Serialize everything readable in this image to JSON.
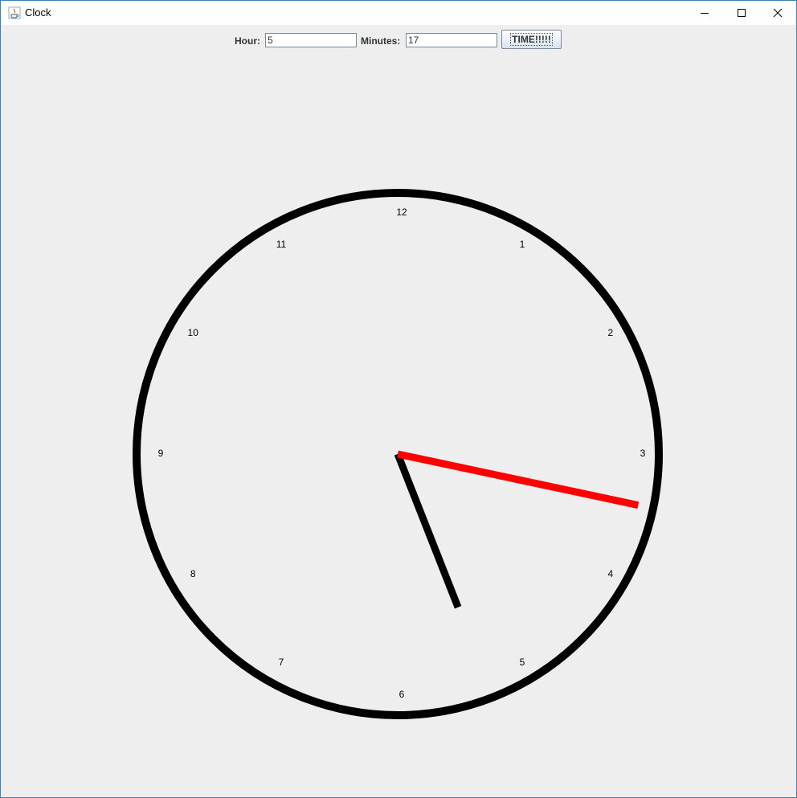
{
  "window": {
    "title": "Clock",
    "app_icon": "java-icon",
    "controls": [
      "minimize-icon",
      "maximize-icon",
      "close-icon"
    ]
  },
  "toolbar": {
    "hour_label": "Hour:",
    "hour_value": "5",
    "minutes_label": "Minutes:",
    "minutes_value": "17",
    "time_button_label": "TIME!!!!!"
  },
  "clock": {
    "numbers": [
      "12",
      "1",
      "2",
      "3",
      "4",
      "5",
      "6",
      "7",
      "8",
      "9",
      "10",
      "11"
    ],
    "hour": 5,
    "minutes": 17,
    "colors": {
      "face_outline": "#000000",
      "hour_hand": "#000000",
      "minute_hand": "#ff0000",
      "background": "#eeeeee"
    }
  }
}
